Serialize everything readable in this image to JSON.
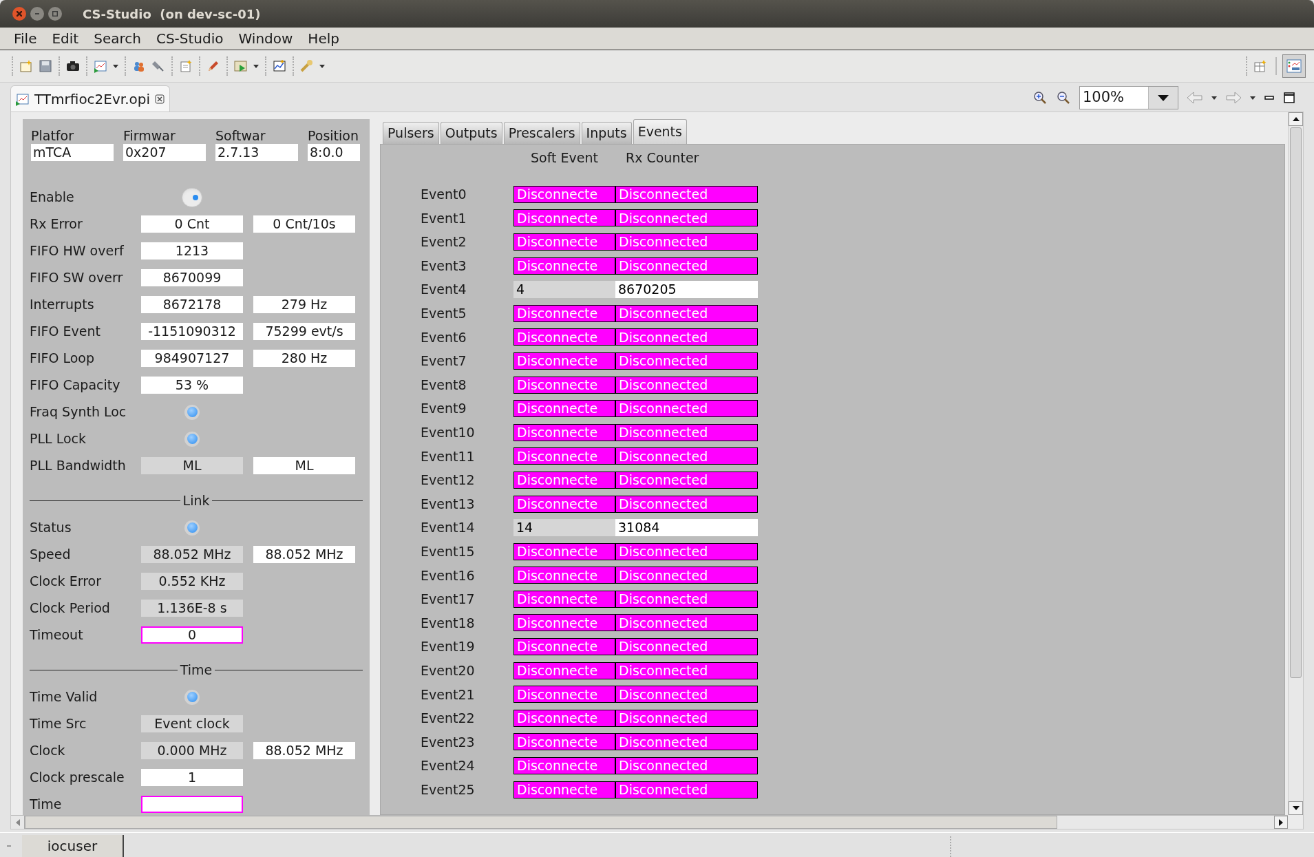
{
  "window": {
    "title": "CS-Studio  (on dev-sc-01)"
  },
  "menu": [
    {
      "label": "File"
    },
    {
      "label": "Edit"
    },
    {
      "label": "Search"
    },
    {
      "label": "CS-Studio"
    },
    {
      "label": "Window"
    },
    {
      "label": "Help"
    }
  ],
  "editor_tab": {
    "title": "TTmrfioc2Evr.opi"
  },
  "zoom_box": {
    "value": "100%"
  },
  "left_panel": {
    "header": [
      {
        "label": "Platfor",
        "value": "mTCA"
      },
      {
        "label": "Firmwar",
        "value": "0x207"
      },
      {
        "label": "Softwar",
        "value": "2.7.13"
      },
      {
        "label": "Position",
        "value": "8:0.0"
      }
    ],
    "rows": [
      {
        "kind": "toggle",
        "label": "Enable",
        "on": true
      },
      {
        "kind": "field",
        "label": "Rx Error",
        "values": [
          {
            "text": "0 Cnt",
            "readonly": false,
            "alarm": false
          },
          {
            "text": "0 Cnt/10s",
            "readonly": false,
            "alarm": false
          }
        ]
      },
      {
        "kind": "field",
        "label": "FIFO HW overf",
        "values": [
          {
            "text": "1213",
            "readonly": false,
            "alarm": false
          }
        ]
      },
      {
        "kind": "field",
        "label": "FIFO SW overr",
        "values": [
          {
            "text": "8670099",
            "readonly": false,
            "alarm": false
          }
        ]
      },
      {
        "kind": "field",
        "label": "Interrupts",
        "values": [
          {
            "text": "8672178",
            "readonly": false,
            "alarm": false
          },
          {
            "text": "279 Hz",
            "readonly": false,
            "alarm": false
          }
        ]
      },
      {
        "kind": "field",
        "label": "FIFO Event",
        "values": [
          {
            "text": "-1151090312",
            "readonly": false,
            "alarm": false
          },
          {
            "text": "75299 evt/s",
            "readonly": false,
            "alarm": false
          }
        ]
      },
      {
        "kind": "field",
        "label": "FIFO Loop",
        "values": [
          {
            "text": "984907127",
            "readonly": false,
            "alarm": false
          },
          {
            "text": "280 Hz",
            "readonly": false,
            "alarm": false
          }
        ]
      },
      {
        "kind": "field",
        "label": "FIFO Capacity",
        "values": [
          {
            "text": "53 %",
            "readonly": false,
            "alarm": false
          }
        ]
      },
      {
        "kind": "led",
        "label": "Fraq Synth Loc",
        "on": true
      },
      {
        "kind": "led",
        "label": "PLL Lock",
        "on": true
      },
      {
        "kind": "field",
        "label": "PLL Bandwidth",
        "values": [
          {
            "text": "ML",
            "readonly": true,
            "alarm": false
          },
          {
            "text": "ML",
            "readonly": false,
            "alarm": false
          }
        ]
      },
      {
        "kind": "section",
        "label": "Link"
      },
      {
        "kind": "led",
        "label": "Status",
        "on": true
      },
      {
        "kind": "field",
        "label": "Speed",
        "values": [
          {
            "text": "88.052 MHz",
            "readonly": true,
            "alarm": false
          },
          {
            "text": "88.052 MHz",
            "readonly": false,
            "alarm": false
          }
        ]
      },
      {
        "kind": "field",
        "label": "Clock Error",
        "values": [
          {
            "text": "0.552 KHz",
            "readonly": true,
            "alarm": false
          }
        ]
      },
      {
        "kind": "field",
        "label": "Clock Period",
        "values": [
          {
            "text": "1.136E-8 s",
            "readonly": true,
            "alarm": false
          }
        ]
      },
      {
        "kind": "field",
        "label": "Timeout",
        "values": [
          {
            "text": "0",
            "readonly": false,
            "alarm": true
          }
        ]
      },
      {
        "kind": "section",
        "label": "Time"
      },
      {
        "kind": "led",
        "label": "Time Valid",
        "on": true
      },
      {
        "kind": "field",
        "label": "Time Src",
        "values": [
          {
            "text": "Event clock",
            "readonly": true,
            "alarm": false
          }
        ]
      },
      {
        "kind": "field",
        "label": "Clock",
        "values": [
          {
            "text": "0.000 MHz",
            "readonly": true,
            "alarm": false
          },
          {
            "text": "88.052 MHz",
            "readonly": false,
            "alarm": false
          }
        ]
      },
      {
        "kind": "field",
        "label": "Clock prescale",
        "values": [
          {
            "text": "1",
            "readonly": false,
            "alarm": false
          }
        ]
      },
      {
        "kind": "field",
        "label": "Time",
        "values": [
          {
            "readonly": false,
            "alarm": true
          }
        ]
      }
    ]
  },
  "tabs": [
    {
      "label": "Pulsers",
      "selected": false
    },
    {
      "label": "Outputs",
      "selected": false
    },
    {
      "label": "Prescalers",
      "selected": false
    },
    {
      "label": "Inputs",
      "selected": false
    },
    {
      "label": "Events",
      "selected": true
    }
  ],
  "events": {
    "columns": [
      "Soft Event",
      "Rx Counter"
    ],
    "rows": [
      {
        "label": "Event0",
        "cells": [
          {
            "text": "Disconnecte",
            "disconnected": true
          },
          {
            "text": "Disconnected",
            "disconnected": true
          }
        ]
      },
      {
        "label": "Event1",
        "cells": [
          {
            "text": "Disconnecte",
            "disconnected": true
          },
          {
            "text": "Disconnected",
            "disconnected": true
          }
        ]
      },
      {
        "label": "Event2",
        "cells": [
          {
            "text": "Disconnecte",
            "disconnected": true
          },
          {
            "text": "Disconnected",
            "disconnected": true
          }
        ]
      },
      {
        "label": "Event3",
        "cells": [
          {
            "text": "Disconnecte",
            "disconnected": true
          },
          {
            "text": "Disconnected",
            "disconnected": true
          }
        ]
      },
      {
        "label": "Event4",
        "cells": [
          {
            "text": "4",
            "disconnected": false,
            "readonly": true
          },
          {
            "text": "8670205",
            "disconnected": false,
            "readonly": false
          }
        ]
      },
      {
        "label": "Event5",
        "cells": [
          {
            "text": "Disconnecte",
            "disconnected": true
          },
          {
            "text": "Disconnected",
            "disconnected": true
          }
        ]
      },
      {
        "label": "Event6",
        "cells": [
          {
            "text": "Disconnecte",
            "disconnected": true
          },
          {
            "text": "Disconnected",
            "disconnected": true
          }
        ]
      },
      {
        "label": "Event7",
        "cells": [
          {
            "text": "Disconnecte",
            "disconnected": true
          },
          {
            "text": "Disconnected",
            "disconnected": true
          }
        ]
      },
      {
        "label": "Event8",
        "cells": [
          {
            "text": "Disconnecte",
            "disconnected": true
          },
          {
            "text": "Disconnected",
            "disconnected": true
          }
        ]
      },
      {
        "label": "Event9",
        "cells": [
          {
            "text": "Disconnecte",
            "disconnected": true
          },
          {
            "text": "Disconnected",
            "disconnected": true
          }
        ]
      },
      {
        "label": "Event10",
        "cells": [
          {
            "text": "Disconnecte",
            "disconnected": true
          },
          {
            "text": "Disconnected",
            "disconnected": true
          }
        ]
      },
      {
        "label": "Event11",
        "cells": [
          {
            "text": "Disconnecte",
            "disconnected": true
          },
          {
            "text": "Disconnected",
            "disconnected": true
          }
        ]
      },
      {
        "label": "Event12",
        "cells": [
          {
            "text": "Disconnecte",
            "disconnected": true
          },
          {
            "text": "Disconnected",
            "disconnected": true
          }
        ]
      },
      {
        "label": "Event13",
        "cells": [
          {
            "text": "Disconnecte",
            "disconnected": true
          },
          {
            "text": "Disconnected",
            "disconnected": true
          }
        ]
      },
      {
        "label": "Event14",
        "cells": [
          {
            "text": "14",
            "disconnected": false,
            "readonly": true
          },
          {
            "text": "31084",
            "disconnected": false,
            "readonly": false
          }
        ]
      },
      {
        "label": "Event15",
        "cells": [
          {
            "text": "Disconnecte",
            "disconnected": true
          },
          {
            "text": "Disconnected",
            "disconnected": true
          }
        ]
      },
      {
        "label": "Event16",
        "cells": [
          {
            "text": "Disconnecte",
            "disconnected": true
          },
          {
            "text": "Disconnected",
            "disconnected": true
          }
        ]
      },
      {
        "label": "Event17",
        "cells": [
          {
            "text": "Disconnecte",
            "disconnected": true
          },
          {
            "text": "Disconnected",
            "disconnected": true
          }
        ]
      },
      {
        "label": "Event18",
        "cells": [
          {
            "text": "Disconnecte",
            "disconnected": true
          },
          {
            "text": "Disconnected",
            "disconnected": true
          }
        ]
      },
      {
        "label": "Event19",
        "cells": [
          {
            "text": "Disconnecte",
            "disconnected": true
          },
          {
            "text": "Disconnected",
            "disconnected": true
          }
        ]
      },
      {
        "label": "Event20",
        "cells": [
          {
            "text": "Disconnecte",
            "disconnected": true
          },
          {
            "text": "Disconnected",
            "disconnected": true
          }
        ]
      },
      {
        "label": "Event21",
        "cells": [
          {
            "text": "Disconnecte",
            "disconnected": true
          },
          {
            "text": "Disconnected",
            "disconnected": true
          }
        ]
      },
      {
        "label": "Event22",
        "cells": [
          {
            "text": "Disconnecte",
            "disconnected": true
          },
          {
            "text": "Disconnected",
            "disconnected": true
          }
        ]
      },
      {
        "label": "Event23",
        "cells": [
          {
            "text": "Disconnecte",
            "disconnected": true
          },
          {
            "text": "Disconnected",
            "disconnected": true
          }
        ]
      },
      {
        "label": "Event24",
        "cells": [
          {
            "text": "Disconnecte",
            "disconnected": true
          },
          {
            "text": "Disconnected",
            "disconnected": true
          }
        ]
      },
      {
        "label": "Event25",
        "cells": [
          {
            "text": "Disconnecte",
            "disconnected": true
          },
          {
            "text": "Disconnected",
            "disconnected": true
          }
        ]
      }
    ]
  },
  "status_bar": {
    "user": "iocuser"
  }
}
